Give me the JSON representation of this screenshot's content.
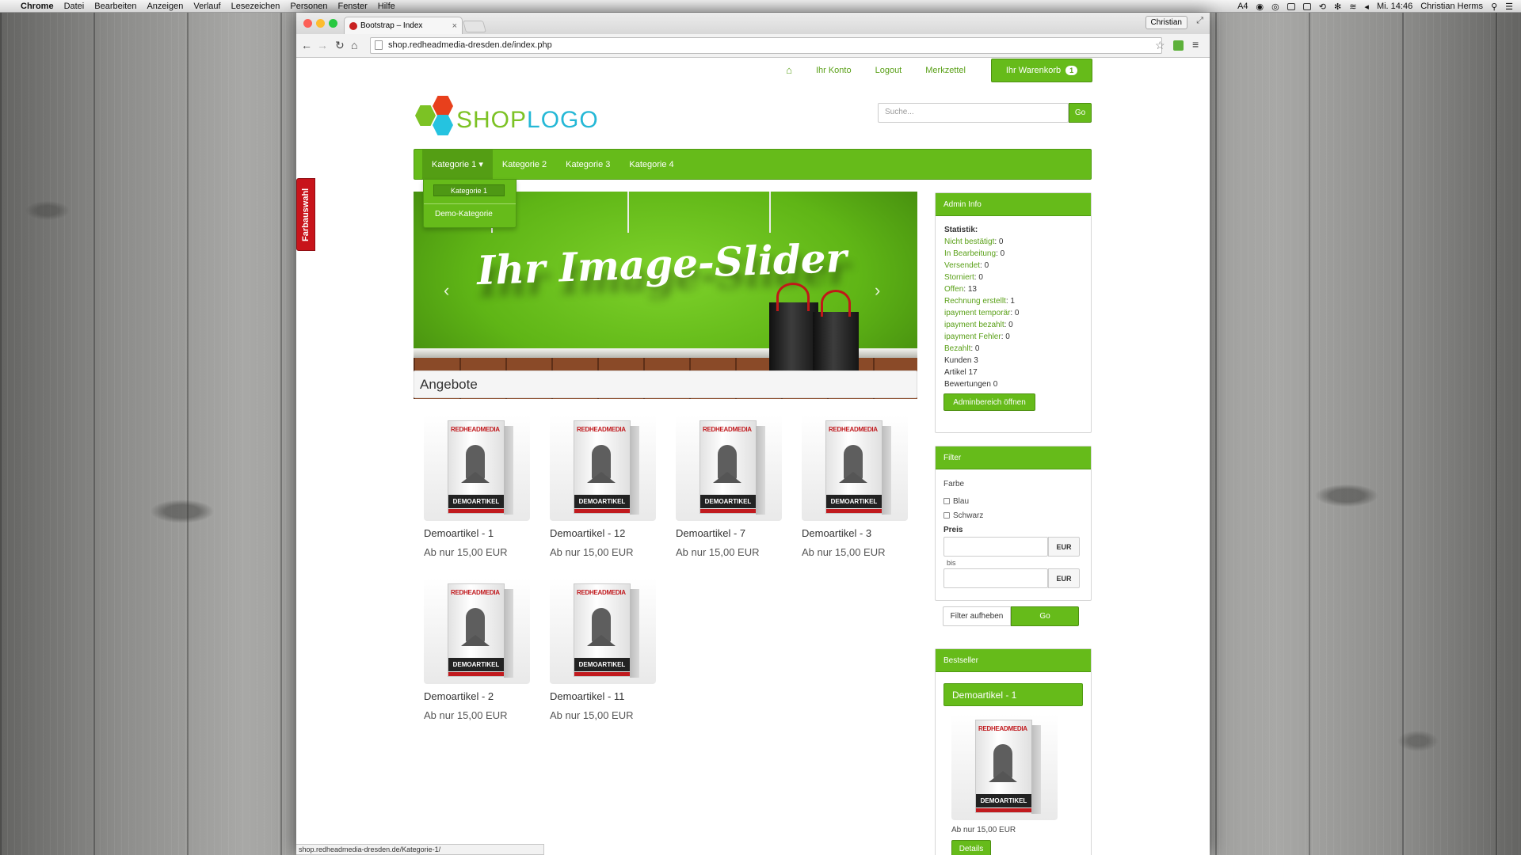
{
  "menubar": {
    "app": "Chrome",
    "items": [
      "Datei",
      "Bearbeiten",
      "Anzeigen",
      "Verlauf",
      "Lesezeichen",
      "Personen",
      "Fenster",
      "Hilfe"
    ],
    "status_text": "Mi. 14:46",
    "user": "Christian Herms",
    "badge_num": "4"
  },
  "browser": {
    "tab_title": "Bootstrap – Index",
    "profile": "Christian",
    "url": "shop.redheadmedia-dresden.de/index.php",
    "status_url": "shop.redheadmedia-dresden.de/Kategorie-1/"
  },
  "topnav": {
    "account": "Ihr Konto",
    "logout": "Logout",
    "wishlist": "Merkzettel",
    "cart": "Ihr Warenkorb",
    "cart_count": "1"
  },
  "logo": {
    "shop": "SHOP",
    "logo": "LOGO"
  },
  "search": {
    "placeholder": "Suche...",
    "button": "Go"
  },
  "categories": [
    "Kategorie 1",
    "Kategorie 2",
    "Kategorie 3",
    "Kategorie 4"
  ],
  "dropdown": {
    "item1": "Kategorie 1",
    "item2": "Demo-Kategorie"
  },
  "side_tab": "Farbauswahl",
  "slider": {
    "headline": "Ihr Image-Slider",
    "prev": "‹",
    "next": "›"
  },
  "offers": {
    "title": "Angebote",
    "products": [
      {
        "name": "Demoartikel - 1",
        "price": "Ab nur 15,00 EUR"
      },
      {
        "name": "Demoartikel - 12",
        "price": "Ab nur 15,00 EUR"
      },
      {
        "name": "Demoartikel - 7",
        "price": "Ab nur 15,00 EUR"
      },
      {
        "name": "Demoartikel - 3",
        "price": "Ab nur 15,00 EUR"
      },
      {
        "name": "Demoartikel - 2",
        "price": "Ab nur 15,00 EUR"
      },
      {
        "name": "Demoartikel - 11",
        "price": "Ab nur 15,00 EUR"
      }
    ],
    "box_brand": "REDHEADMEDIA",
    "box_label": "DEMOARTIKEL"
  },
  "admin": {
    "title": "Admin Info",
    "stat_heading": "Statistik:",
    "stats": [
      {
        "label": "Nicht bestätigt",
        "value": ": 0"
      },
      {
        "label": "In Bearbeitung",
        "value": ": 0"
      },
      {
        "label": "Versendet",
        "value": ": 0"
      },
      {
        "label": "Storniert",
        "value": ": 0"
      },
      {
        "label": "Offen",
        "value": ": 13"
      },
      {
        "label": "Rechnung erstellt",
        "value": ": 1"
      },
      {
        "label": "ipayment temporär",
        "value": ": 0"
      },
      {
        "label": "ipayment bezahlt",
        "value": ": 0"
      },
      {
        "label": "ipayment Fehler",
        "value": ": 0"
      },
      {
        "label": "Bezahlt",
        "value": ": 0"
      }
    ],
    "plain": [
      "Kunden 3",
      "Artikel 17",
      "Bewertungen 0"
    ],
    "button": "Adminbereich öffnen"
  },
  "filter": {
    "title": "Filter",
    "color_label": "Farbe",
    "colors": [
      "Blau",
      "Schwarz"
    ],
    "price_label": "Preis",
    "currency": "EUR",
    "to": "bis",
    "reset": "Filter aufheben",
    "go": "Go"
  },
  "bestseller": {
    "title": "Bestseller",
    "product_name": "Demoartikel - 1",
    "price": "Ab nur 15,00 EUR",
    "details": "Details"
  },
  "colors": {
    "primary_green": "#66bb1a",
    "farb_red": "#c8141b"
  }
}
